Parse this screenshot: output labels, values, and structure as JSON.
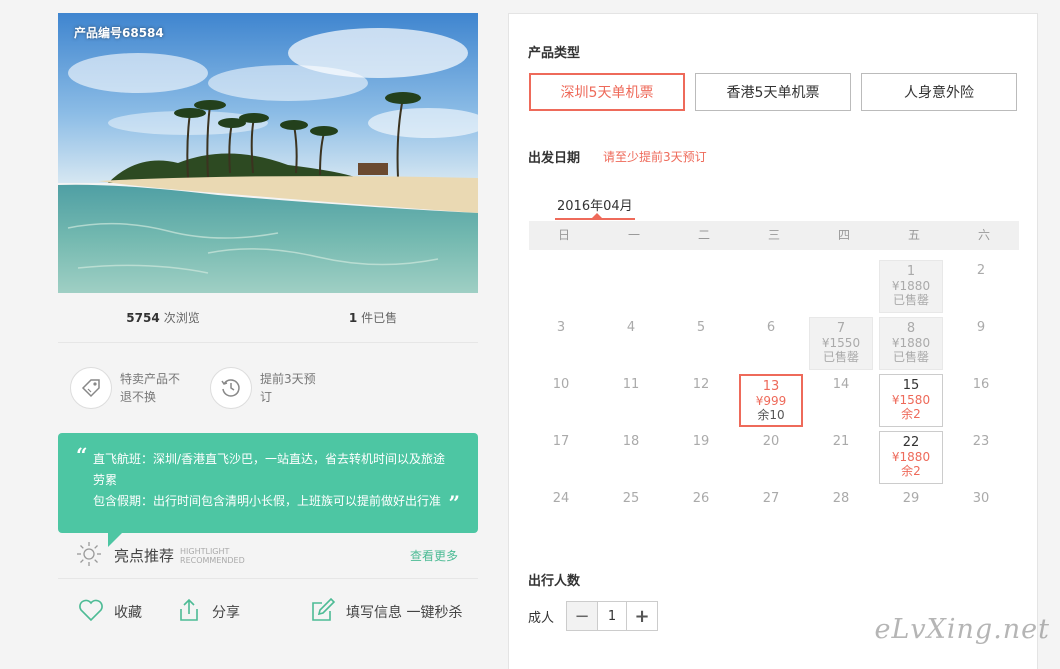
{
  "product": {
    "id_label": "产品编号68584",
    "views_count": "5754",
    "views_label": "次浏览",
    "sold_count": "1",
    "sold_label": "件已售"
  },
  "promises": [
    {
      "text": "特卖产品不退不换",
      "icon": "tag-icon"
    },
    {
      "text": "提前3天预订",
      "icon": "clock-icon"
    }
  ],
  "highlight": {
    "line1": "直飞航班：深圳/香港直飞沙巴，一站直达，省去转机时间以及旅途劳累",
    "line2": "包含假期：出行时间包含清明小长假，上班族可以提前做好出行准",
    "title": "亮点推荐",
    "en1": "HIGHTLIGHT",
    "en2": "RECOMMENDED",
    "more": "查看更多"
  },
  "actions": {
    "favorite": "收藏",
    "share": "分享",
    "fill": "填写信息 一键秒杀"
  },
  "panel": {
    "type_title": "产品类型",
    "types": [
      "深圳5天单机票",
      "香港5天单机票",
      "人身意外险"
    ],
    "selected_type": 0,
    "date_title": "出发日期",
    "date_tip": "请至少提前3天预订",
    "month": "2016年04月",
    "weekdays": [
      "日",
      "一",
      "二",
      "三",
      "四",
      "五",
      "六"
    ],
    "count_title": "出行人数",
    "adult_label": "成人",
    "adult_count": "1"
  },
  "calendar": {
    "first_weekday": 5,
    "days_in_month": 30,
    "special": {
      "1": {
        "state": "sold",
        "price": "¥1880",
        "remark": "已售罄"
      },
      "7": {
        "state": "sold",
        "price": "¥1550",
        "remark": "已售罄"
      },
      "8": {
        "state": "sold",
        "price": "¥1880",
        "remark": "已售罄"
      },
      "13": {
        "state": "selected",
        "price": "¥999",
        "remark": "余10"
      },
      "15": {
        "state": "available",
        "price": "¥1580",
        "remark": "余2"
      },
      "22": {
        "state": "available",
        "price": "¥1880",
        "remark": "余2"
      }
    }
  },
  "watermark": "eLvXing.net",
  "colors": {
    "accent": "#ee6a5a",
    "green": "#4dc6a3"
  }
}
